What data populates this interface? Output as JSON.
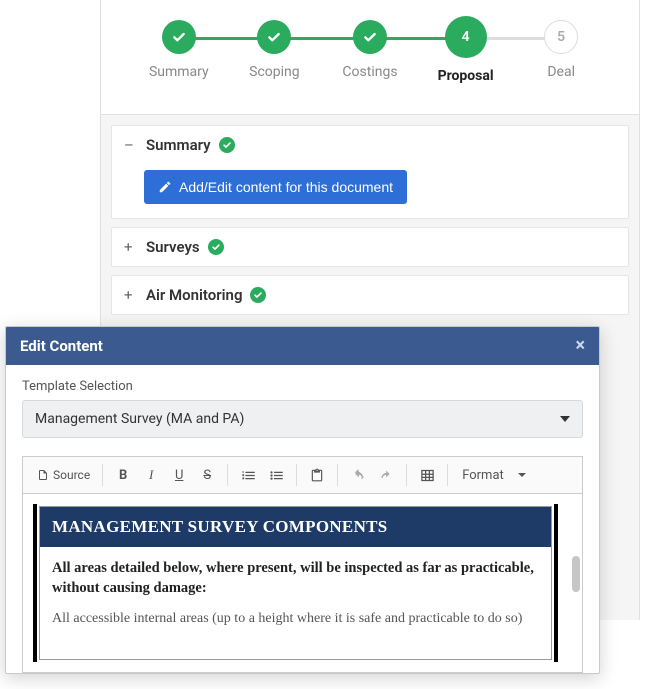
{
  "stepper": {
    "steps": [
      {
        "label": "Summary",
        "state": "done"
      },
      {
        "label": "Scoping",
        "state": "done"
      },
      {
        "label": "Costings",
        "state": "done"
      },
      {
        "label": "Proposal",
        "state": "current",
        "number": "4"
      },
      {
        "label": "Deal",
        "state": "future",
        "number": "5"
      }
    ]
  },
  "accordion": {
    "items": [
      {
        "title": "Summary",
        "expanded": true,
        "complete": true
      },
      {
        "title": "Surveys",
        "expanded": false,
        "complete": true
      },
      {
        "title": "Air Monitoring",
        "expanded": false,
        "complete": true
      }
    ],
    "edit_button_label": "Add/Edit content for this document"
  },
  "modal": {
    "title": "Edit Content",
    "template_label": "Template Selection",
    "template_value": "Management Survey (MA and PA)"
  },
  "toolbar": {
    "source_label": "Source",
    "format_label": "Format"
  },
  "document": {
    "heading": "MANAGEMENT SURVEY COMPONENTS",
    "lead": "All areas detailed below, where present, will be inspected as far as practicable, without causing damage:",
    "para1": "All accessible internal areas (up to a height where it is safe and practicable to do so)"
  }
}
